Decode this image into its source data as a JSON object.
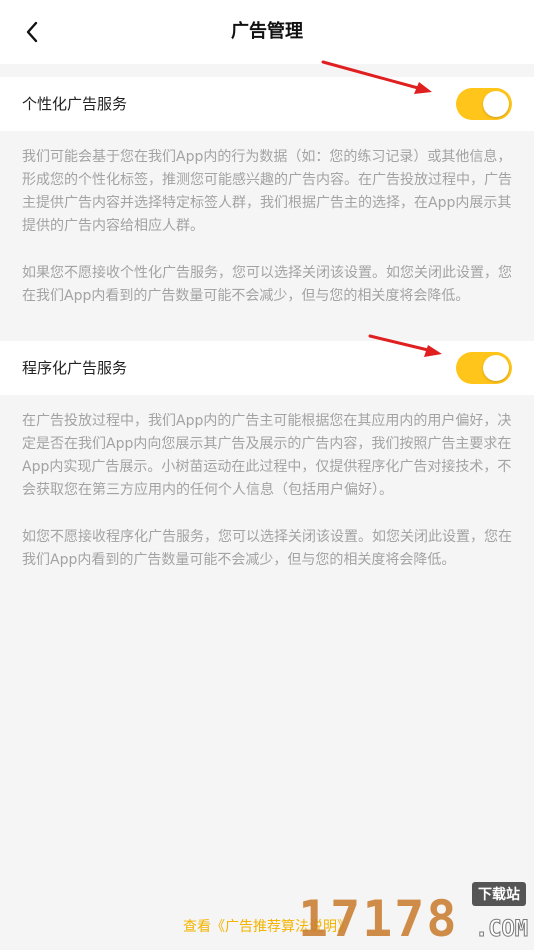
{
  "header": {
    "title": "广告管理",
    "back_icon": "chevron-left-icon"
  },
  "personalized": {
    "label": "个性化广告服务",
    "enabled": true,
    "toggle_color": "#ffc51a",
    "desc_p1": "我们可能会基于您在我们App内的行为数据（如：您的练习记录）或其他信息，形成您的个性化标签，推测您可能感兴趣的广告内容。在广告投放过程中，广告主提供广告内容并选择特定标签人群，我们根据广告主的选择，在App内展示其提供的广告内容给相应人群。",
    "desc_p2": "如果您不愿接收个性化广告服务，您可以选择关闭该设置。如您关闭此设置，您在我们App内看到的广告数量可能不会减少，但与您的相关度将会降低。"
  },
  "programmatic": {
    "label": "程序化广告服务",
    "enabled": true,
    "desc_p1": "在广告投放过程中，我们App内的广告主可能根据您在其应用内的用户偏好，决定是否在我们App内向您展示其广告及展示的广告内容，我们按照广告主要求在App内实现广告展示。小树苗运动在此过程中，仅提供程序化广告对接技术，不会获取您在第三方应用内的任何个人信息（包括用户偏好）。",
    "desc_p2": "如您不愿接收程序化广告服务，您可以选择关闭该设置。如您关闭此设置，您在我们App内看到的广告数量可能不会减少，但与您的相关度将会降低。"
  },
  "footer": {
    "link": "查看《广告推荐算法说明》",
    "link_color": "#f4b400"
  },
  "annotation": {
    "arrow_color": "#e02020"
  },
  "watermark": {
    "number": "17178",
    "badge": "下载站",
    "domain": ".COM"
  }
}
